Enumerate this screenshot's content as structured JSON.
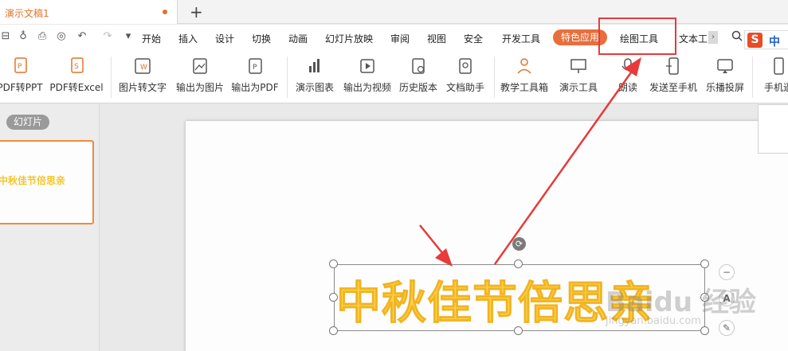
{
  "titlebar": {
    "doc_tab": "演示文稿1",
    "new_tab": "+"
  },
  "menu": {
    "items": [
      "开始",
      "插入",
      "设计",
      "切换",
      "动画",
      "幻灯片放映",
      "审阅",
      "视图",
      "安全",
      "开发工具"
    ],
    "active_pill": "特色应用",
    "highlighted": "绘图工具",
    "partial": "文本工",
    "more": "›"
  },
  "ime": {
    "logo": "S",
    "mode": "中"
  },
  "ribbon": {
    "tools": [
      {
        "label": "PDF转PPT",
        "icon": "pdf-to-ppt-icon"
      },
      {
        "label": "PDF转Excel",
        "icon": "pdf-to-excel-icon"
      },
      {
        "label": "图片转文字",
        "icon": "image-to-text-icon"
      },
      {
        "label": "输出为图片",
        "icon": "export-image-icon"
      },
      {
        "label": "输出为PDF",
        "icon": "export-pdf-icon"
      },
      {
        "label": "演示图表",
        "icon": "chart-icon"
      },
      {
        "label": "输出为视频",
        "icon": "export-video-icon"
      },
      {
        "label": "历史版本",
        "icon": "history-icon"
      },
      {
        "label": "文档助手",
        "icon": "doc-assistant-icon"
      },
      {
        "label": "教学工具箱",
        "icon": "teaching-toolbox-icon"
      },
      {
        "label": "演示工具",
        "icon": "presentation-tools-icon"
      },
      {
        "label": "朗读",
        "icon": "read-aloud-icon"
      },
      {
        "label": "发送至手机",
        "icon": "send-to-phone-icon"
      },
      {
        "label": "乐播投屏",
        "icon": "cast-screen-icon"
      },
      {
        "label": "手机遥",
        "icon": "phone-remote-icon"
      }
    ]
  },
  "leftpane": {
    "tag": "幻灯片",
    "thumb_text": "中秋佳节倍思亲"
  },
  "slide": {
    "title": "中秋佳节倍思亲",
    "title_color": "#fcd34d"
  },
  "float_buttons": [
    "−",
    "A",
    "✎"
  ],
  "watermark": {
    "main": "Baidu 经验",
    "sub": "jingyan.baidu.com"
  },
  "annotation": {
    "color": "#e83a3a"
  }
}
